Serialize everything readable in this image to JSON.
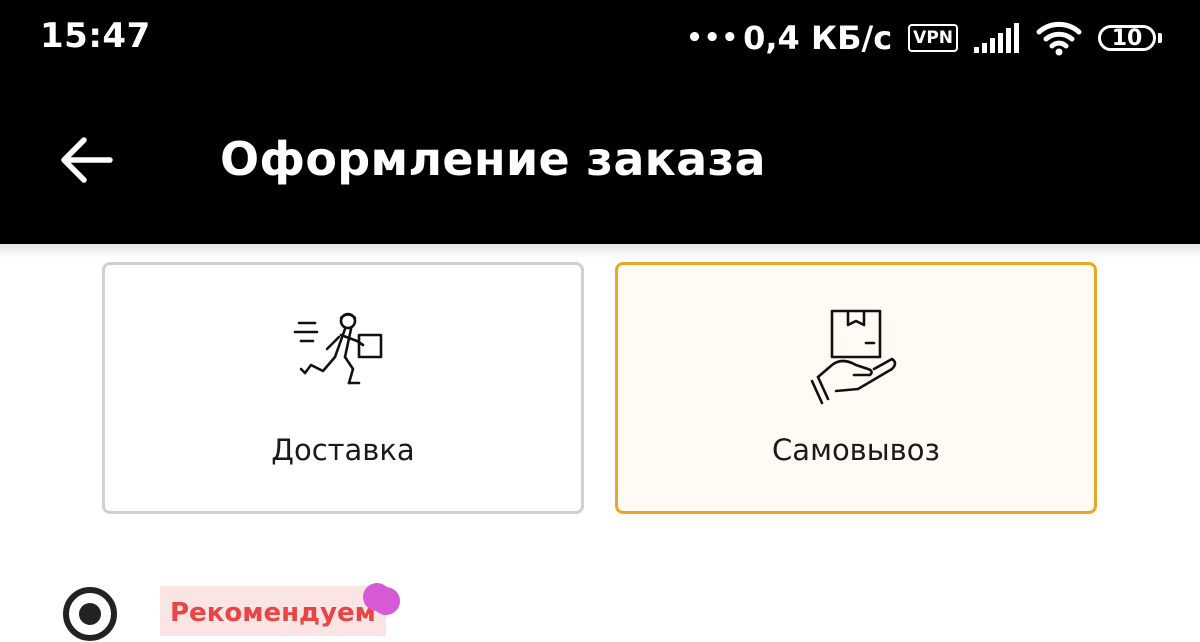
{
  "status_bar": {
    "time": "15:47",
    "dots": "•••",
    "speed": "0,4 КБ/с",
    "vpn": "VPN",
    "battery": "10",
    "icons": [
      "signal-icon",
      "wifi-icon",
      "battery-icon"
    ]
  },
  "header": {
    "back_icon": "arrow-left-icon",
    "title": "Оформление заказа"
  },
  "delivery_options": {
    "selected": "pickup",
    "items": [
      {
        "id": "delivery",
        "label": "Доставка",
        "icon": "courier-icon"
      },
      {
        "id": "pickup",
        "label": "Самовывоз",
        "icon": "hand-package-icon"
      }
    ]
  },
  "recommendation": {
    "badge": "Рекомендуем",
    "radio_icon": "radio-icon"
  },
  "colors": {
    "bar_background": "#000000",
    "selected_border": "#e8a826",
    "selected_fill": "#fffbf4",
    "card_border": "#d0d0d0",
    "badge_text": "#e84545",
    "badge_bg": "#fbe4e4",
    "dot": "#d65ad6"
  }
}
